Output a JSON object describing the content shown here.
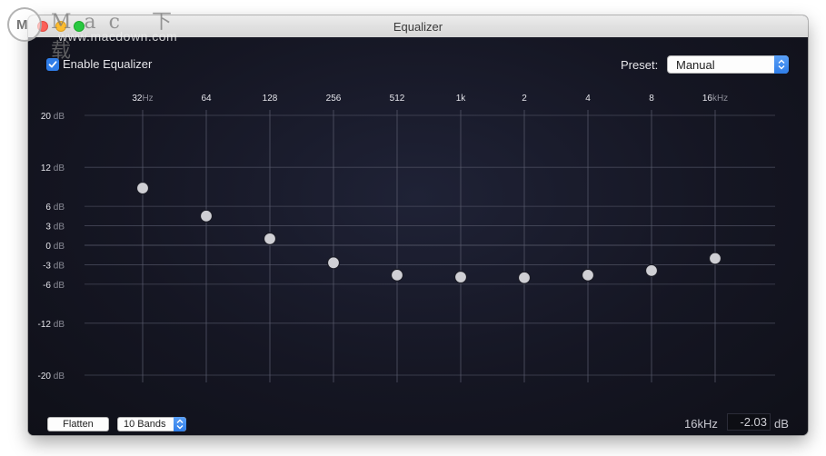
{
  "window": {
    "title": "Equalizer"
  },
  "watermark": {
    "logo_text": "M",
    "top_text": "Mac 下载",
    "url": "www.macdown.com"
  },
  "enable": {
    "label": "Enable Equalizer",
    "checked": true
  },
  "preset": {
    "label": "Preset:",
    "value": "Manual"
  },
  "bands": [
    {
      "freq": "32",
      "unit": "Hz",
      "gain_db": 8.8
    },
    {
      "freq": "64",
      "unit": "",
      "gain_db": 4.5
    },
    {
      "freq": "128",
      "unit": "",
      "gain_db": 1.0
    },
    {
      "freq": "256",
      "unit": "",
      "gain_db": -2.7
    },
    {
      "freq": "512",
      "unit": "",
      "gain_db": -4.6
    },
    {
      "freq": "1k",
      "unit": "",
      "gain_db": -4.9
    },
    {
      "freq": "2",
      "unit": "",
      "gain_db": -5.0
    },
    {
      "freq": "4",
      "unit": "",
      "gain_db": -4.6
    },
    {
      "freq": "8",
      "unit": "",
      "gain_db": -3.9
    },
    {
      "freq": "16",
      "unit": "kHz",
      "gain_db": -2.03
    }
  ],
  "db_scale": [
    {
      "value": "20",
      "db": 20
    },
    {
      "value": "12",
      "db": 12
    },
    {
      "value": "6",
      "db": 6
    },
    {
      "value": "3",
      "db": 3
    },
    {
      "value": "0",
      "db": 0
    },
    {
      "value": "-3",
      "db": -3
    },
    {
      "value": "-6",
      "db": -6
    },
    {
      "value": "-12",
      "db": -12
    },
    {
      "value": "-20",
      "db": -20
    }
  ],
  "db_unit": "dB",
  "footer": {
    "flatten_label": "Flatten",
    "bands_value": "10 Bands",
    "selected_freq": "16kHz",
    "selected_value": "-2.03",
    "value_unit": "dB"
  },
  "colors": {
    "accent": "#2f7de8",
    "grid": "#5a5c6e",
    "knob": "#cfcfd4"
  }
}
